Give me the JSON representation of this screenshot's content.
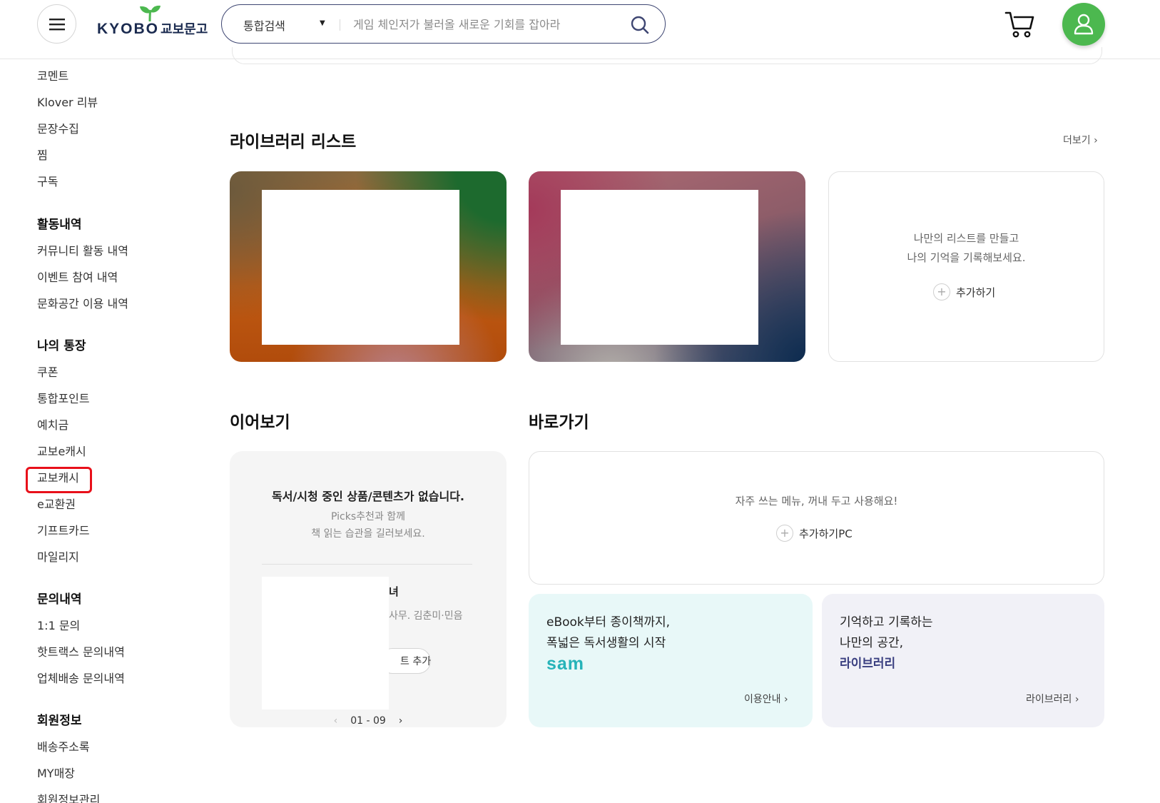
{
  "header": {
    "logo_text": "KYOBO",
    "logo_text_kor": "교보문고",
    "search_scope": "통합검색",
    "search_placeholder": "게임 체인저가 불러올 새로운 기회를 잡아라",
    "icons": [
      "menu-icon",
      "search-icon",
      "cart-icon",
      "user-icon"
    ],
    "brand_color": "#4cb84f"
  },
  "sidebar": {
    "top_items": [
      "코멘트",
      "Klover 리뷰",
      "문장수집",
      "찜",
      "구독"
    ],
    "groups": [
      {
        "heading": "활동내역",
        "items": [
          "커뮤니티 활동 내역",
          "이벤트 참여 내역",
          "문화공간 이용 내역"
        ]
      },
      {
        "heading": "나의 통장",
        "items": [
          "쿠폰",
          "통합포인트",
          "예치금",
          "교보e캐시",
          "교보캐시",
          "e교환권",
          "기프트카드",
          "마일리지"
        ]
      },
      {
        "heading": "문의내역",
        "items": [
          "1:1 문의",
          "핫트랙스 문의내역",
          "업체배송 문의내역"
        ]
      },
      {
        "heading": "회원정보",
        "items": [
          "배송주소록",
          "MY매장",
          "회원정보관리"
        ]
      }
    ],
    "highlighted_item": "교보캐시",
    "highlight_color": "#e8101a"
  },
  "library": {
    "title": "라이브러리 리스트",
    "more": "더보기",
    "add_message_line1": "나만의 리스트를 만들고",
    "add_message_line2": "나의 기억을 기록해보세요.",
    "add_label": "추가하기"
  },
  "continue": {
    "title": "이어보기",
    "empty_title": "독서/시청 중인 상품/콘텐츠가 없습니다.",
    "empty_sub_line1": "Picks추천과 함께",
    "empty_sub_line2": "책 읽는 습관을 길러보세요.",
    "book_title_fragment": "녀",
    "book_author_fragment": "사무. 김춘미·민음",
    "button_fragment": "트 추가",
    "pager": "01 - 09"
  },
  "shortcut": {
    "title": "바로가기",
    "message": "자주 쓰는 메뉴, 꺼내 두고 사용해요!",
    "add_label": "추가하기PC"
  },
  "promos": {
    "sam": {
      "line1": "eBook부터 종이책까지,",
      "line2": "폭넓은 독서생활의 시작",
      "brand": "sam",
      "link": "이용안내",
      "bg_color": "#e8f8f8",
      "brand_color": "#26b3b9"
    },
    "library": {
      "line1": "기억하고 기록하는",
      "line2": "나만의 공간,",
      "emph": "라이브러리",
      "link": "라이브러리",
      "bg_color": "#f1f1f7"
    }
  }
}
